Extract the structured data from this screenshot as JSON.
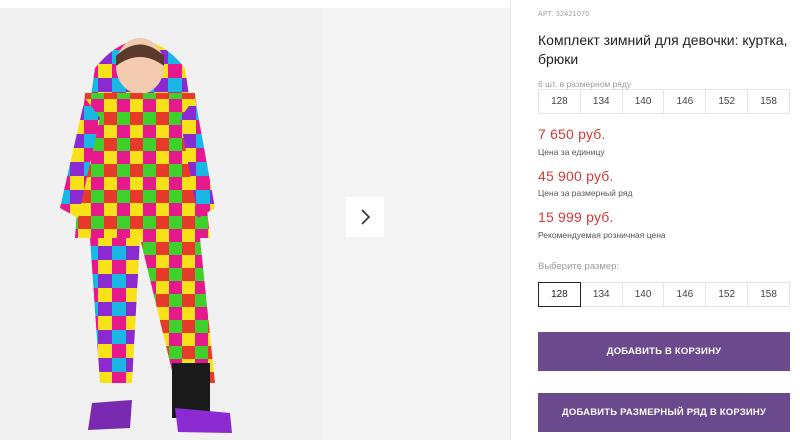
{
  "product": {
    "article": "АРТ. 32421070",
    "title": "Комплект зимний для девочки: куртка, брюки"
  },
  "pack": {
    "label": "6 шт. в размерном ряду",
    "sizes": [
      "128",
      "134",
      "140",
      "146",
      "152",
      "158"
    ]
  },
  "prices": {
    "unit_price": "7 650 руб.",
    "unit_note": "Цена за единицу",
    "pack_price": "45 900 руб.",
    "pack_note": "Цена за размерный ряд",
    "retail_price": "15 999 руб.",
    "retail_note": "Рекомендуемая розничная цена",
    "color": "#d23a3a"
  },
  "size_select": {
    "label": "Выберите размер:",
    "sizes": [
      "128",
      "134",
      "140",
      "146",
      "152",
      "158"
    ],
    "selected": "128"
  },
  "buttons": {
    "add_to_cart": "ДОБАВИТЬ В КОРЗИНУ",
    "add_pack_to_cart": "ДОБАВИТЬ РАЗМЕРНЫЙ РЯД В КОРЗИНУ",
    "color": "#6a4a8c"
  },
  "gallery": {
    "main_image": "girl-in-colorful-winter-suit-photo",
    "next_icon": "chevron-right-icon"
  }
}
